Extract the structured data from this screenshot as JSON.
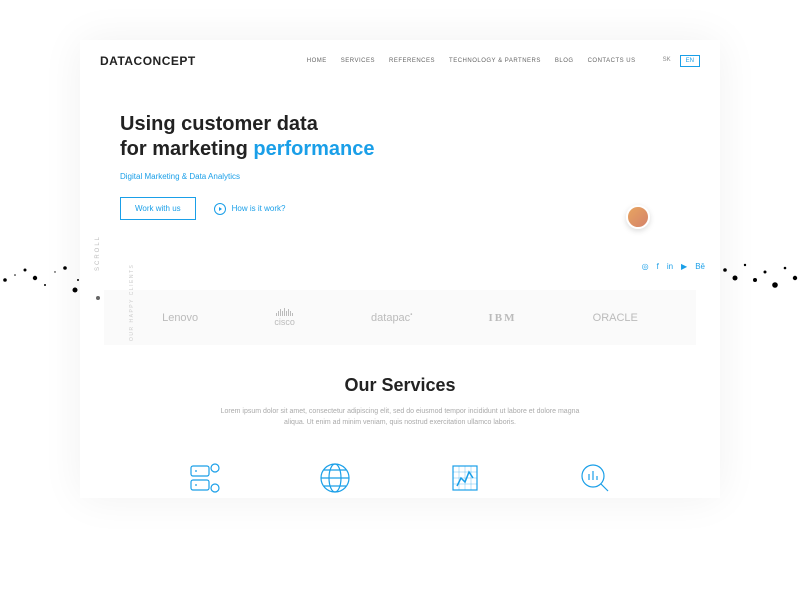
{
  "logo": {
    "part1": "DATA",
    "part2": "CONCEPT"
  },
  "nav": {
    "home": "HOME",
    "services": "SERVICES",
    "references": "REFERENCES",
    "tech": "TECHNOLOGY & PARTNERS",
    "blog": "BLOG",
    "contact": "CONTACTS US"
  },
  "lang": {
    "sk": "SK",
    "en": "EN"
  },
  "hero": {
    "line1": "Using customer data",
    "line2a": "for marketing ",
    "line2b": "performance",
    "subtitle": "Digital Marketing & Data Analytics",
    "cta": "Work with us",
    "how": "How is it work?"
  },
  "scroll": "SCROLL",
  "clientsLabel": "OUR HAPPY CLIENTS",
  "clients": {
    "lenovo": "Lenovo",
    "cisco": "cisco",
    "datapac": "datapac",
    "ibm": "IBM",
    "oracle": "ORACLE"
  },
  "services": {
    "title": "Our Services",
    "desc": "Lorem ipsum dolor sit amet, consectetur adipiscing elit, sed do eiusmod tempor incididunt ut labore et dolore magna aliqua. Ut enim ad minim veniam, quis nostrud exercitation ullamco laboris."
  }
}
